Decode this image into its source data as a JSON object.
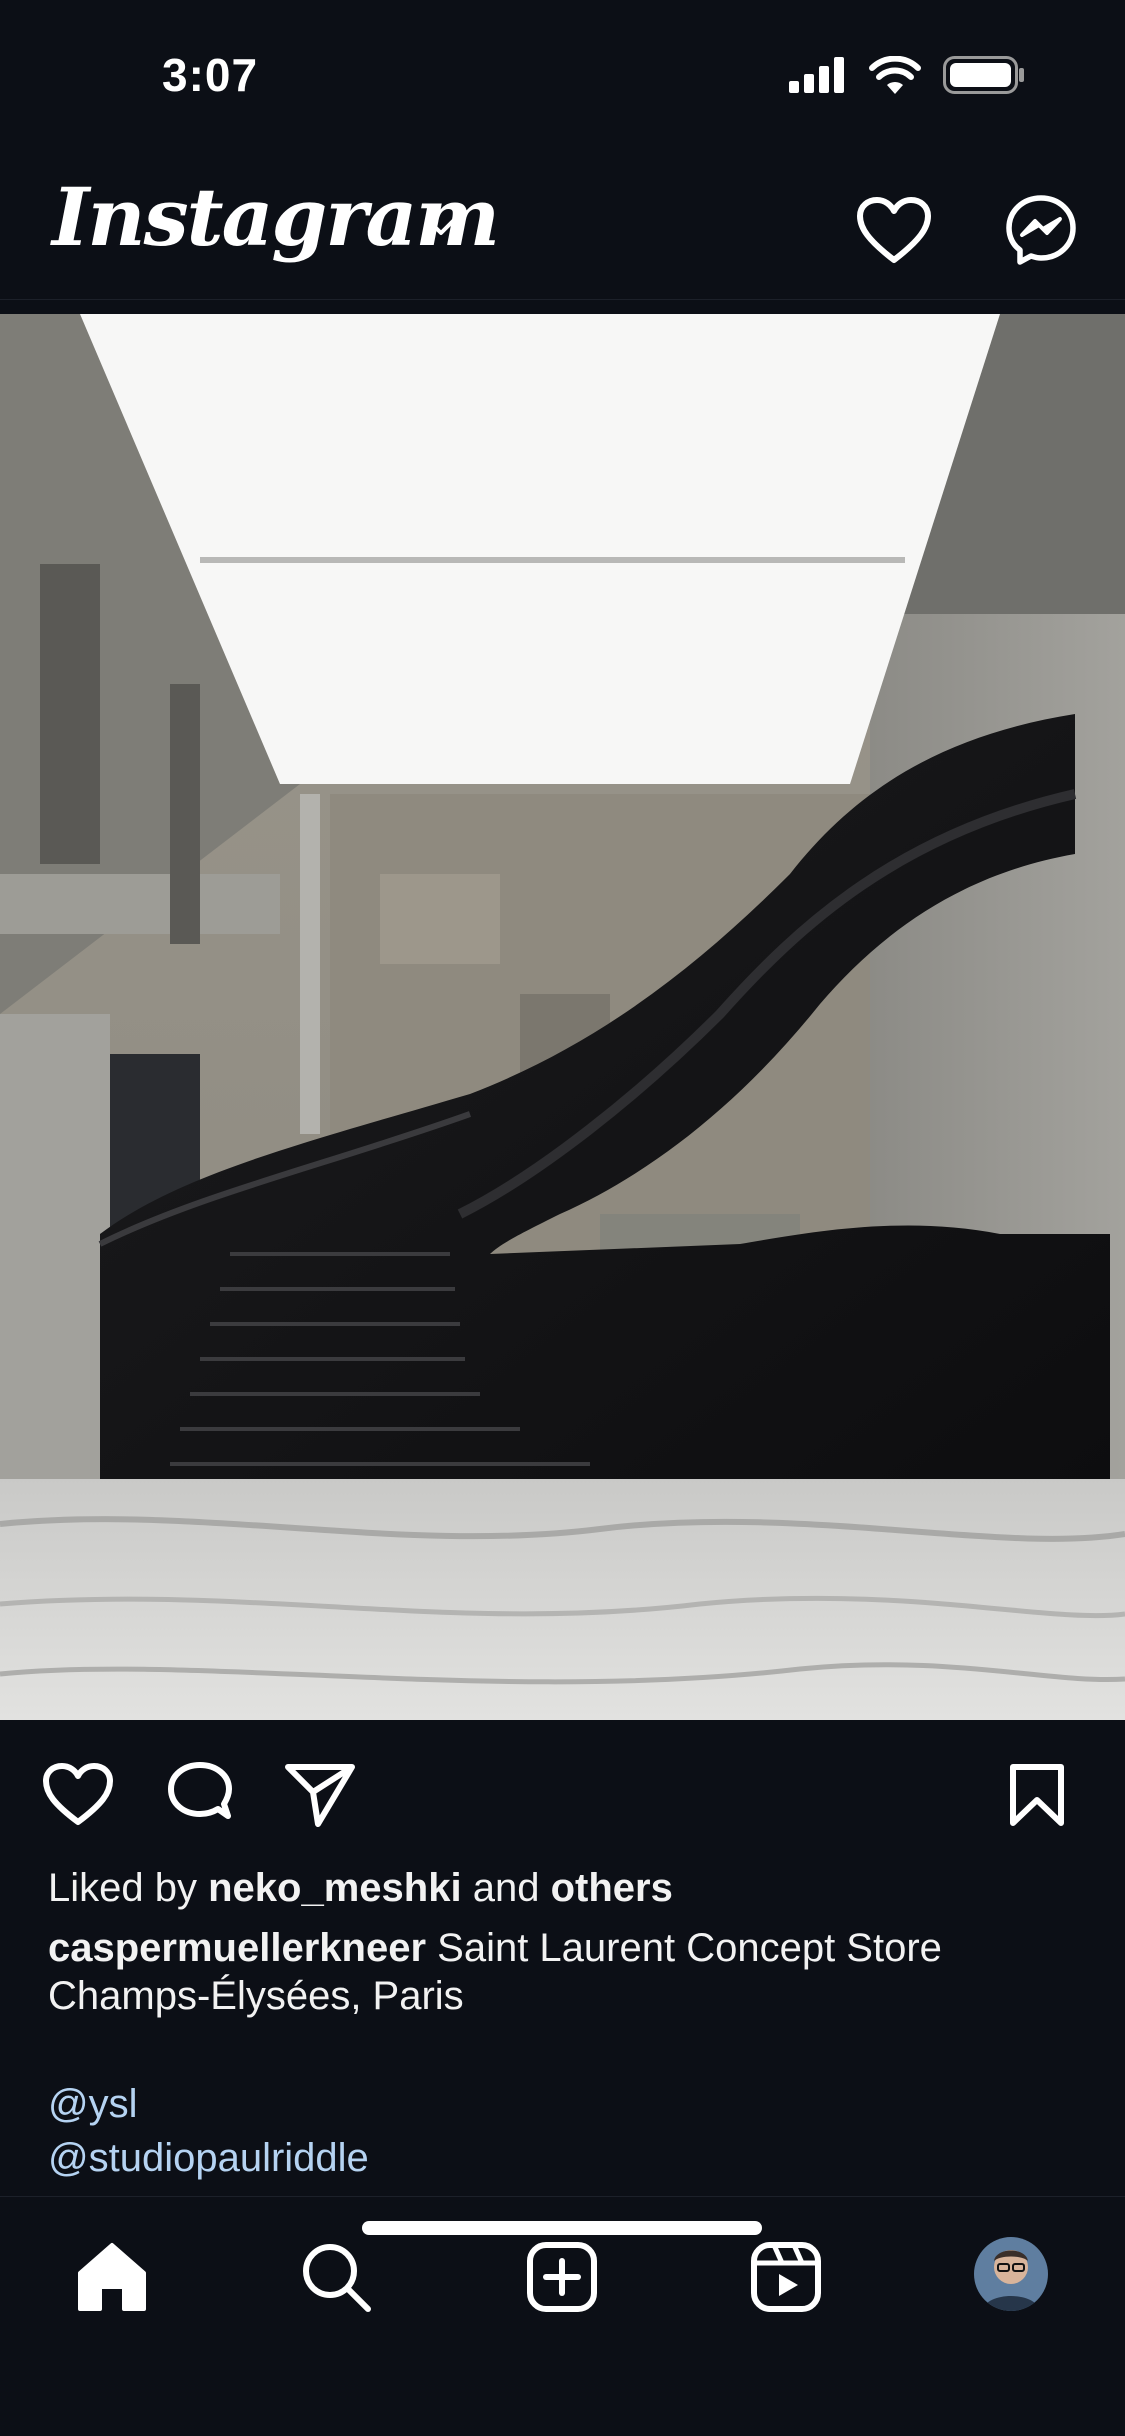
{
  "status_bar": {
    "time": "3:07",
    "icons": [
      "signal-icon",
      "wifi-icon",
      "battery-icon"
    ]
  },
  "header": {
    "logo": "Instagram",
    "icons": [
      "chevron-down-icon",
      "heart-icon",
      "messenger-icon"
    ]
  },
  "post": {
    "image_subject": "black spiral staircase in concrete interior",
    "liked_by_prefix": "Liked by",
    "liked_by_user": "neko_meshki",
    "liked_by_and": "and",
    "liked_by_others": "others",
    "caption_user": "caspermuellerkneer",
    "caption_text": "Saint Laurent Concept Store Champs-Élysées, Paris",
    "mentions": [
      "@ysl",
      "@studiopaulriddle"
    ],
    "actions": [
      "like-icon",
      "comment-icon",
      "share-icon",
      "save-icon"
    ]
  },
  "bottom_nav": {
    "items": [
      "home-icon",
      "search-icon",
      "new-post-icon",
      "reels-icon",
      "profile-avatar"
    ]
  },
  "colors": {
    "background": "#0c0f16",
    "mention": "#b5d3f2",
    "text": "#f2f2f2"
  }
}
